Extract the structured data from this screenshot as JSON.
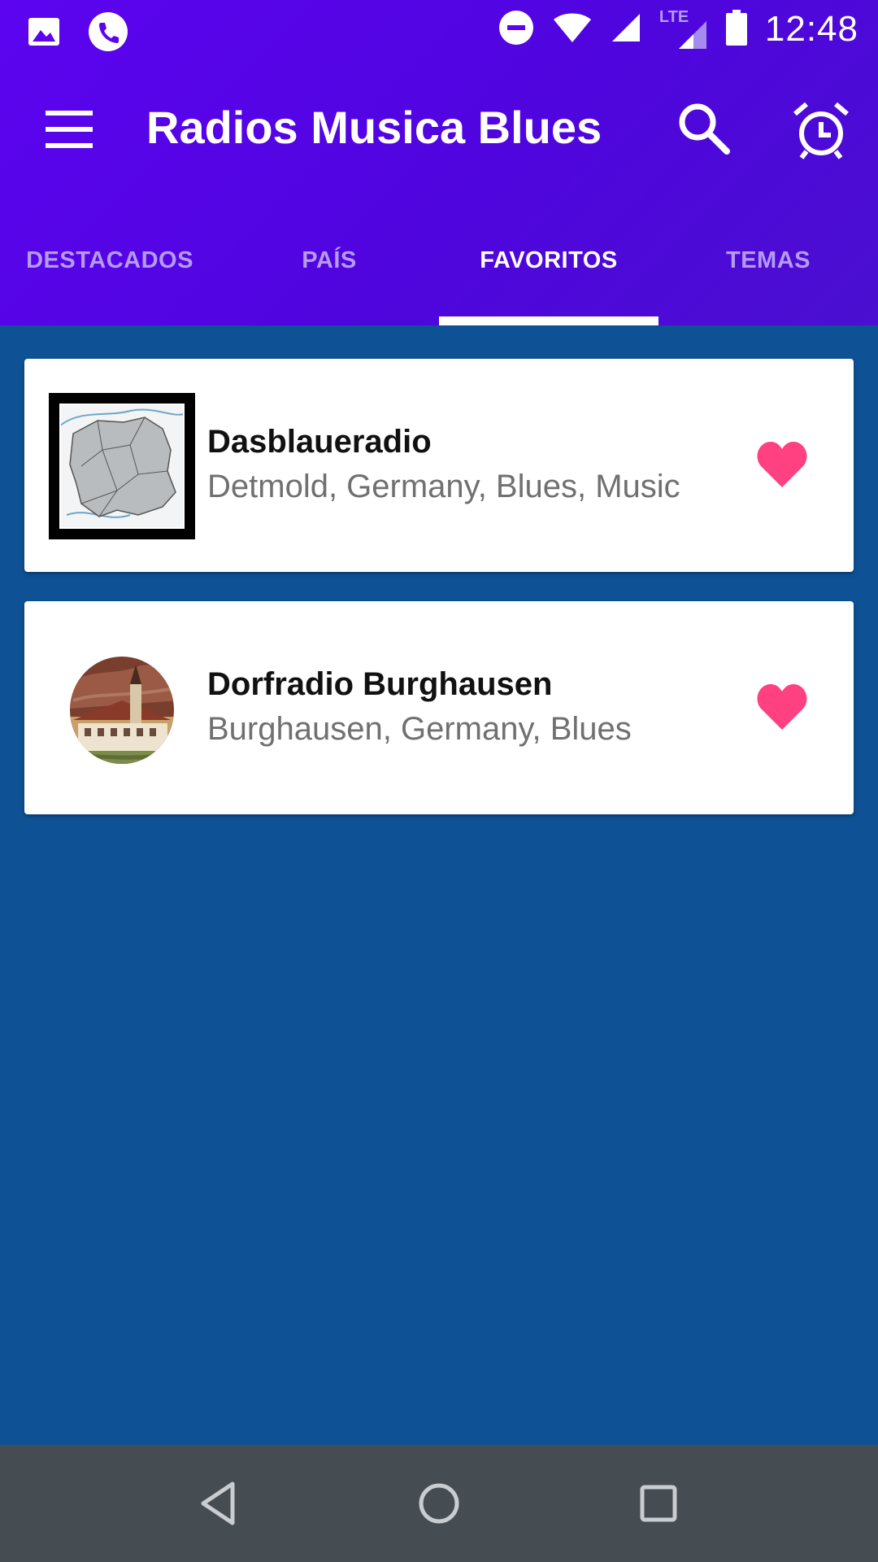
{
  "status_bar": {
    "time": "12:48",
    "network_label": "LTE",
    "left_icons": [
      "image-icon",
      "phone-icon"
    ],
    "right_icons": [
      "do-not-disturb-icon",
      "wifi-icon",
      "signal-icon",
      "lte-signal-icon",
      "battery-icon"
    ]
  },
  "app_bar": {
    "title": "Radios Musica Blues",
    "menu_icon": "menu-icon",
    "search_icon": "search-icon",
    "alarm_icon": "alarm-icon"
  },
  "tabs": [
    {
      "label": "DESTACADOS",
      "active": false
    },
    {
      "label": "PAÍS",
      "active": false
    },
    {
      "label": "FAVORITOS",
      "active": true
    },
    {
      "label": "TEMAS",
      "active": false
    }
  ],
  "favorites": [
    {
      "name": "Dasblaueradio",
      "details": "Detmold, Germany, Blues, Music",
      "thumbnail": "map-image",
      "favorite": true
    },
    {
      "name": "Dorfradio Burghausen",
      "details": "Burghausen, Germany, Blues",
      "thumbnail": "village-image",
      "favorite": true
    }
  ],
  "nav_bar": {
    "back_icon": "back-icon",
    "home_icon": "home-icon",
    "recents_icon": "recents-icon"
  },
  "colors": {
    "app_bar": "#5C04F0",
    "background": "#0E5194",
    "heart": "#FF4081",
    "nav_bar": "#454C52"
  }
}
